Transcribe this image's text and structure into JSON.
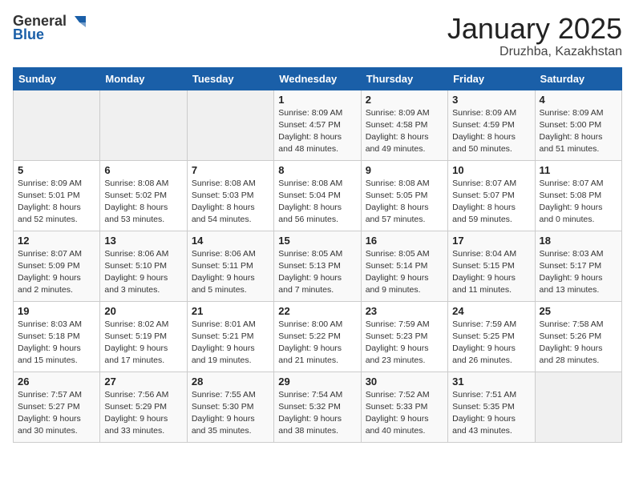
{
  "header": {
    "logo_general": "General",
    "logo_blue": "Blue",
    "title": "January 2025",
    "subtitle": "Druzhba, Kazakhstan"
  },
  "calendar": {
    "days_of_week": [
      "Sunday",
      "Monday",
      "Tuesday",
      "Wednesday",
      "Thursday",
      "Friday",
      "Saturday"
    ],
    "weeks": [
      [
        {
          "day": "",
          "info": ""
        },
        {
          "day": "",
          "info": ""
        },
        {
          "day": "",
          "info": ""
        },
        {
          "day": "1",
          "info": "Sunrise: 8:09 AM\nSunset: 4:57 PM\nDaylight: 8 hours\nand 48 minutes."
        },
        {
          "day": "2",
          "info": "Sunrise: 8:09 AM\nSunset: 4:58 PM\nDaylight: 8 hours\nand 49 minutes."
        },
        {
          "day": "3",
          "info": "Sunrise: 8:09 AM\nSunset: 4:59 PM\nDaylight: 8 hours\nand 50 minutes."
        },
        {
          "day": "4",
          "info": "Sunrise: 8:09 AM\nSunset: 5:00 PM\nDaylight: 8 hours\nand 51 minutes."
        }
      ],
      [
        {
          "day": "5",
          "info": "Sunrise: 8:09 AM\nSunset: 5:01 PM\nDaylight: 8 hours\nand 52 minutes."
        },
        {
          "day": "6",
          "info": "Sunrise: 8:08 AM\nSunset: 5:02 PM\nDaylight: 8 hours\nand 53 minutes."
        },
        {
          "day": "7",
          "info": "Sunrise: 8:08 AM\nSunset: 5:03 PM\nDaylight: 8 hours\nand 54 minutes."
        },
        {
          "day": "8",
          "info": "Sunrise: 8:08 AM\nSunset: 5:04 PM\nDaylight: 8 hours\nand 56 minutes."
        },
        {
          "day": "9",
          "info": "Sunrise: 8:08 AM\nSunset: 5:05 PM\nDaylight: 8 hours\nand 57 minutes."
        },
        {
          "day": "10",
          "info": "Sunrise: 8:07 AM\nSunset: 5:07 PM\nDaylight: 8 hours\nand 59 minutes."
        },
        {
          "day": "11",
          "info": "Sunrise: 8:07 AM\nSunset: 5:08 PM\nDaylight: 9 hours\nand 0 minutes."
        }
      ],
      [
        {
          "day": "12",
          "info": "Sunrise: 8:07 AM\nSunset: 5:09 PM\nDaylight: 9 hours\nand 2 minutes."
        },
        {
          "day": "13",
          "info": "Sunrise: 8:06 AM\nSunset: 5:10 PM\nDaylight: 9 hours\nand 3 minutes."
        },
        {
          "day": "14",
          "info": "Sunrise: 8:06 AM\nSunset: 5:11 PM\nDaylight: 9 hours\nand 5 minutes."
        },
        {
          "day": "15",
          "info": "Sunrise: 8:05 AM\nSunset: 5:13 PM\nDaylight: 9 hours\nand 7 minutes."
        },
        {
          "day": "16",
          "info": "Sunrise: 8:05 AM\nSunset: 5:14 PM\nDaylight: 9 hours\nand 9 minutes."
        },
        {
          "day": "17",
          "info": "Sunrise: 8:04 AM\nSunset: 5:15 PM\nDaylight: 9 hours\nand 11 minutes."
        },
        {
          "day": "18",
          "info": "Sunrise: 8:03 AM\nSunset: 5:17 PM\nDaylight: 9 hours\nand 13 minutes."
        }
      ],
      [
        {
          "day": "19",
          "info": "Sunrise: 8:03 AM\nSunset: 5:18 PM\nDaylight: 9 hours\nand 15 minutes."
        },
        {
          "day": "20",
          "info": "Sunrise: 8:02 AM\nSunset: 5:19 PM\nDaylight: 9 hours\nand 17 minutes."
        },
        {
          "day": "21",
          "info": "Sunrise: 8:01 AM\nSunset: 5:21 PM\nDaylight: 9 hours\nand 19 minutes."
        },
        {
          "day": "22",
          "info": "Sunrise: 8:00 AM\nSunset: 5:22 PM\nDaylight: 9 hours\nand 21 minutes."
        },
        {
          "day": "23",
          "info": "Sunrise: 7:59 AM\nSunset: 5:23 PM\nDaylight: 9 hours\nand 23 minutes."
        },
        {
          "day": "24",
          "info": "Sunrise: 7:59 AM\nSunset: 5:25 PM\nDaylight: 9 hours\nand 26 minutes."
        },
        {
          "day": "25",
          "info": "Sunrise: 7:58 AM\nSunset: 5:26 PM\nDaylight: 9 hours\nand 28 minutes."
        }
      ],
      [
        {
          "day": "26",
          "info": "Sunrise: 7:57 AM\nSunset: 5:27 PM\nDaylight: 9 hours\nand 30 minutes."
        },
        {
          "day": "27",
          "info": "Sunrise: 7:56 AM\nSunset: 5:29 PM\nDaylight: 9 hours\nand 33 minutes."
        },
        {
          "day": "28",
          "info": "Sunrise: 7:55 AM\nSunset: 5:30 PM\nDaylight: 9 hours\nand 35 minutes."
        },
        {
          "day": "29",
          "info": "Sunrise: 7:54 AM\nSunset: 5:32 PM\nDaylight: 9 hours\nand 38 minutes."
        },
        {
          "day": "30",
          "info": "Sunrise: 7:52 AM\nSunset: 5:33 PM\nDaylight: 9 hours\nand 40 minutes."
        },
        {
          "day": "31",
          "info": "Sunrise: 7:51 AM\nSunset: 5:35 PM\nDaylight: 9 hours\nand 43 minutes."
        },
        {
          "day": "",
          "info": ""
        }
      ]
    ]
  }
}
